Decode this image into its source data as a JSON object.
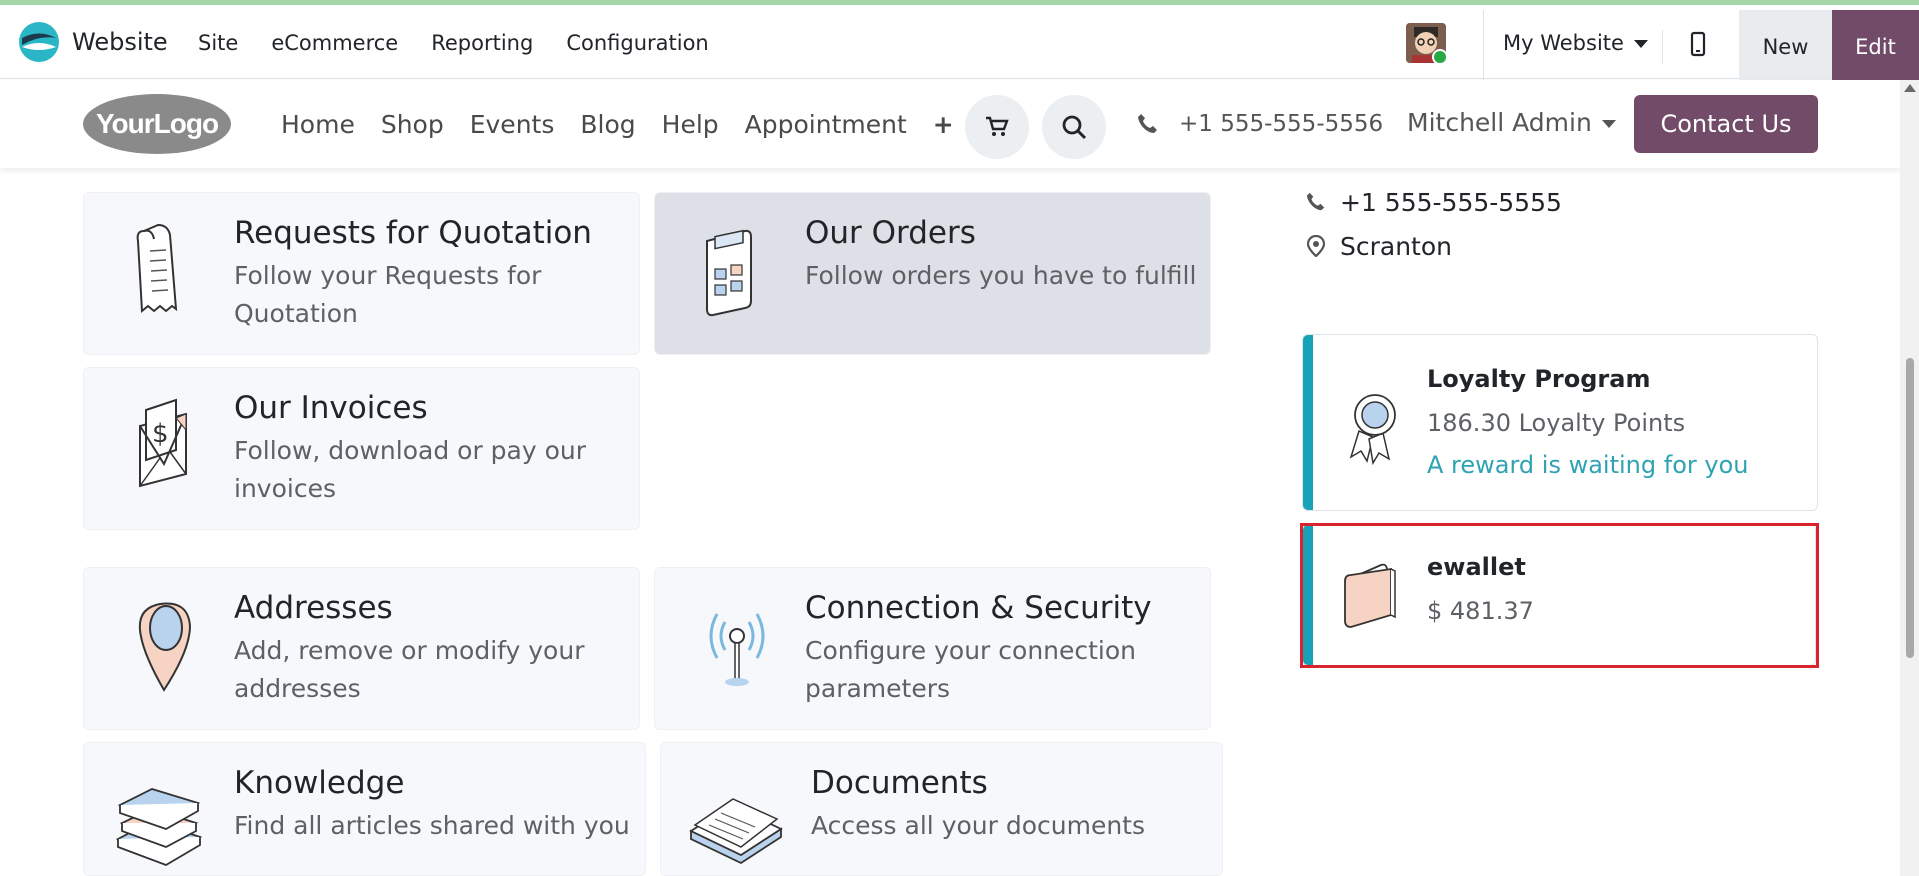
{
  "app": {
    "name": "Website"
  },
  "top_menu": [
    "Site",
    "eCommerce",
    "Reporting",
    "Configuration"
  ],
  "topbar": {
    "website_selector": "My Website",
    "new_label": "New",
    "edit_label": "Edit"
  },
  "site_nav": {
    "logo_text": "YourLogo",
    "items": [
      "Home",
      "Shop",
      "Events",
      "Blog",
      "Help",
      "Appointment"
    ],
    "plus": "+",
    "phone": "+1 555-555-5556",
    "user": "Mitchell Admin",
    "contact_button": "Contact Us"
  },
  "cards": [
    {
      "title": "Requests for Quotation",
      "desc": "Follow your Requests for Quotation",
      "icon": "receipt-icon"
    },
    {
      "title": "Our Orders",
      "desc": "Follow orders you have to fulfill",
      "icon": "calculator-icon"
    },
    {
      "title": "Our Invoices",
      "desc": "Follow, download or pay our invoices",
      "icon": "invoice-envelope-icon"
    },
    {
      "title": "Addresses",
      "desc": "Add, remove or modify your addresses",
      "icon": "map-pin-icon"
    },
    {
      "title": "Connection & Security",
      "desc": "Configure your connection parameters",
      "icon": "antenna-icon"
    },
    {
      "title": "Knowledge",
      "desc": "Find all articles shared with you",
      "icon": "books-icon"
    },
    {
      "title": "Documents",
      "desc": "Access all your documents",
      "icon": "documents-icon"
    }
  ],
  "contact_info": {
    "phone": "+1 555-555-5555",
    "city": "Scranton"
  },
  "loyalty": {
    "title": "Loyalty Program",
    "points": "186.30 Loyalty Points",
    "reward": "A reward is waiting for you"
  },
  "wallet": {
    "title": "ewallet",
    "amount": "$ 481.37"
  },
  "colors": {
    "brand": "#714b67",
    "accent": "#17a2b8",
    "highlight": "#d9232d"
  }
}
